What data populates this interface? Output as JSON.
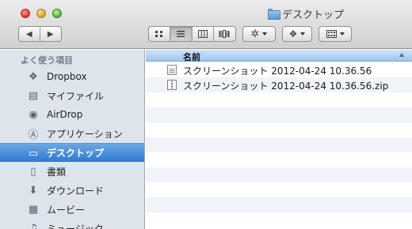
{
  "window": {
    "title": "デスクトップ"
  },
  "toolbar": {
    "back_glyph": "◀",
    "forward_glyph": "▶",
    "view_icons": [
      "icon-view-icon",
      "list-view-icon",
      "column-view-icon",
      "coverflow-view-icon"
    ],
    "active_view": "list"
  },
  "sidebar": {
    "heading": "よく使う項目",
    "items": [
      {
        "label": "Dropbox",
        "icon": "dropbox-icon",
        "glyph": "❖"
      },
      {
        "label": "マイファイル",
        "icon": "all-my-files-icon",
        "glyph": "▤"
      },
      {
        "label": "AirDrop",
        "icon": "airdrop-icon",
        "glyph": "◉"
      },
      {
        "label": "アプリケーション",
        "icon": "applications-icon",
        "glyph": "Ⓐ"
      },
      {
        "label": "デスクトップ",
        "icon": "desktop-icon",
        "glyph": "▭",
        "selected": true
      },
      {
        "label": "書類",
        "icon": "documents-icon",
        "glyph": "▯"
      },
      {
        "label": "ダウンロード",
        "icon": "downloads-icon",
        "glyph": "⬇"
      },
      {
        "label": "ムービー",
        "icon": "movies-icon",
        "glyph": "▦"
      },
      {
        "label": "ミュージック",
        "icon": "music-icon",
        "glyph": "♫"
      }
    ]
  },
  "content": {
    "column_header": "名前",
    "files": [
      {
        "name": "スクリーンショット 2012-04-24 10.36.56",
        "icon": "image-file-icon"
      },
      {
        "name": "スクリーンショット 2012-04-24 10.36.56.zip",
        "icon": "zip-file-icon"
      }
    ]
  },
  "colors": {
    "sidebar_bg": "#dde4eb",
    "selection": "#2e7ad1",
    "header_blue": "#9fc6ee",
    "stripe": "#f0f4f9"
  }
}
